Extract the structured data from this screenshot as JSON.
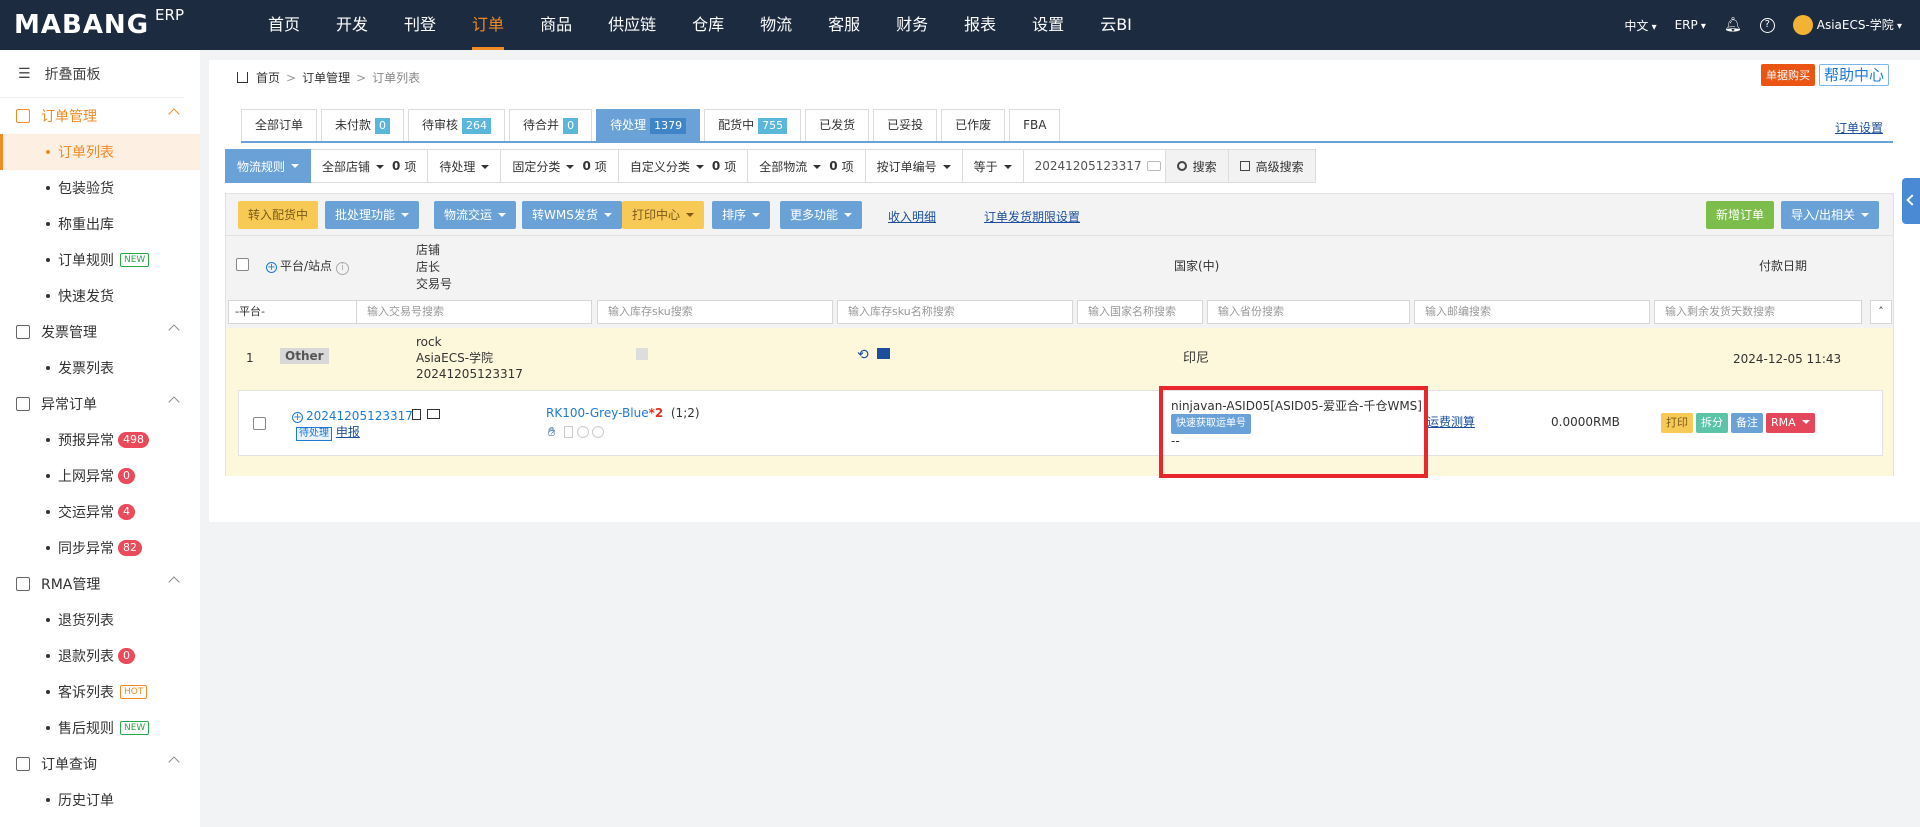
{
  "brand": {
    "logo": "MABANG",
    "sub": "ERP"
  },
  "mainnav": [
    "首页",
    "开发",
    "刊登",
    "订单",
    "商品",
    "供应链",
    "仓库",
    "物流",
    "客服",
    "财务",
    "报表",
    "设置",
    "云BI"
  ],
  "mainnav_active": "订单",
  "topright": {
    "lang": "中文",
    "erp": "ERP",
    "user": "AsiaECS-学院"
  },
  "sidebar": {
    "collapse": "折叠面板",
    "groups": [
      {
        "label": "订单管理",
        "items": [
          "订单列表",
          "包装验货",
          "称重出库",
          "订单规则",
          "快速发货"
        ]
      },
      {
        "label": "发票管理",
        "items": [
          "发票列表"
        ]
      },
      {
        "label": "异常订单",
        "items": [
          "预报异常",
          "上网异常",
          "交运异常",
          "同步异常"
        ]
      },
      {
        "label": "RMA管理",
        "items": [
          "退货列表",
          "退款列表",
          "客诉列表",
          "售后规则"
        ]
      },
      {
        "label": "订单查询",
        "items": [
          "历史订单"
        ]
      }
    ],
    "badges": {
      "new": "NEW",
      "hot": "HOT",
      "预报异常": "498",
      "上网异常": "0",
      "交运异常": "4",
      "同步异常": "82",
      "退款列表": "0"
    }
  },
  "breadcrumb": {
    "home": "首页",
    "level2": "订单管理",
    "current": "订单列表"
  },
  "top_actions": {
    "single_buy": "单据购买",
    "help": "帮助中心"
  },
  "tabs": [
    {
      "label": "全部订单",
      "count": ""
    },
    {
      "label": "未付款",
      "count": "0"
    },
    {
      "label": "待审核",
      "count": "264"
    },
    {
      "label": "待合并",
      "count": "0"
    },
    {
      "label": "待处理",
      "count": "1379"
    },
    {
      "label": "配货中",
      "count": "755"
    },
    {
      "label": "已发货",
      "count": ""
    },
    {
      "label": "已妥投",
      "count": ""
    },
    {
      "label": "已作废",
      "count": ""
    },
    {
      "label": "FBA",
      "count": ""
    }
  ],
  "tabs_active": "待处理",
  "order_settings": "订单设置",
  "filters": {
    "logistics_rule": "物流规则",
    "all_stores": "全部店铺",
    "stores_count": "0",
    "unit": "项",
    "status": "待处理",
    "fixed_cat": "固定分类",
    "fixed_count": "0",
    "custom_cat": "自定义分类",
    "custom_count": "0",
    "all_logistics": "全部物流",
    "logistics_count": "0",
    "by_order_no": "按订单编号",
    "equals": "等于",
    "search_value": "20241205123317",
    "search": "搜索",
    "adv_search": "高级搜索"
  },
  "actions": {
    "to_picking": "转入配货中",
    "batch": "批处理功能",
    "logistics_ship": "物流交运",
    "wms_ship": "转WMS发货",
    "print_center": "打印中心",
    "sort": "排序",
    "more": "更多功能",
    "income_detail": "收入明细",
    "deadline_settings": "订单发货期限设置",
    "new_order": "新增订单",
    "import_export": "导入/出相关"
  },
  "table_header": {
    "platform": "平台/站点",
    "store": "店铺",
    "store_owner": "店长",
    "trade_no": "交易号",
    "country": "国家(中)",
    "pay_date": "付款日期"
  },
  "search_row": {
    "platform_select": "-平台-",
    "placeholders": [
      "输入交易号搜索",
      "输入库存sku搜索",
      "输入库存sku名称搜索",
      "输入国家名称搜索",
      "输入省份搜索",
      "输入邮编搜索",
      "输入剩余发货天数搜索"
    ]
  },
  "order": {
    "index": "1",
    "platform": "Other",
    "store": "rock",
    "store_owner": "AsiaECS-学院",
    "trade_no": "20241205123317",
    "country": "印尼",
    "pay_date": "2024-12-05 11:43",
    "order_no": "20241205123317",
    "status_tag": "待处理",
    "report": "申报",
    "sku": "RK100-Grey-Blue",
    "qty_prefix": "*",
    "qty": "2",
    "qty_note": "(1;2)",
    "logistics": "ninjavan-ASID05[ASID05-爱亚合-千仓WMS]",
    "fetch_tracking": "快速获取运单号",
    "tracking": "--",
    "freight_calc": "运费测算",
    "amount": "0.0000RMB",
    "btn_print": "打印",
    "btn_split": "拆分",
    "btn_note": "备注",
    "btn_rma": "RMA"
  },
  "colors": {
    "nav_bg": "#1c2b3f",
    "accent": "#f08a24",
    "blue": "#6aa2d8",
    "highlight": "#e8262b"
  }
}
